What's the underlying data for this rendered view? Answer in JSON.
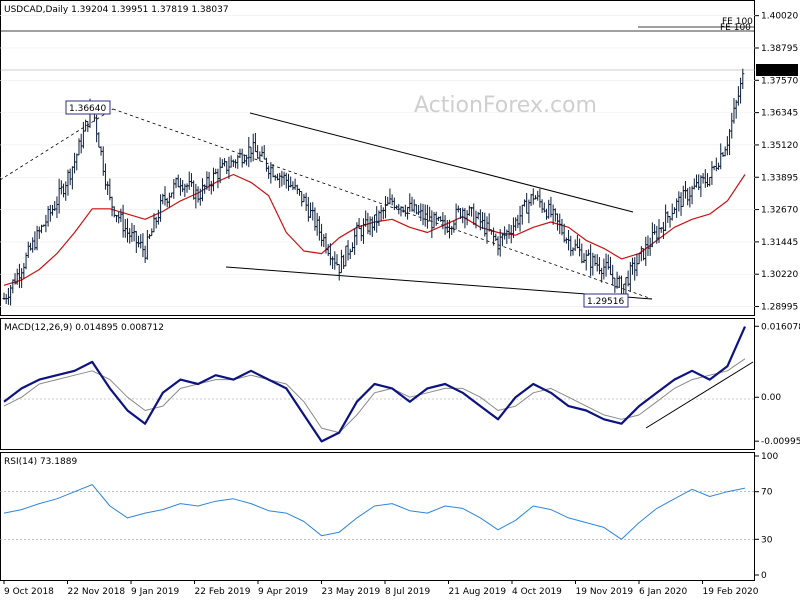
{
  "header": {
    "symbol_line": "USDCAD,Daily  1.39204 1.39951 1.37819 1.38037",
    "watermark": "ActionForex.com",
    "macd_label": "MACD(12,26,9) 0.014895 0.008712",
    "rsi_label": "RSI(14) 73.1889"
  },
  "chart_data": [
    {
      "type": "line",
      "panel": "price",
      "title": "USDCAD,Daily  1.39204 1.39951 1.37819 1.38037",
      "ylim": [
        1.2875,
        1.405
      ],
      "y_ticks": [
        "1.40020",
        "1.38795",
        "1.37570",
        "1.36345",
        "1.35120",
        "1.33895",
        "1.32670",
        "1.31445",
        "1.30220",
        "1.28995"
      ],
      "last_price": "1.38037",
      "annotations": [
        {
          "text": "1.36640",
          "date_index": 49,
          "value": 1.3664
        },
        {
          "text": "1.29516",
          "date_index": 315,
          "value": 1.29516
        },
        {
          "text": "FE 100",
          "value": 1.3936
        },
        {
          "text": "FE 100",
          "value": 1.392
        }
      ],
      "x": [
        "9 Oct 2018",
        "22 Nov 2018",
        "9 Jan 2019",
        "22 Feb 2019",
        "9 Apr 2019",
        "23 May 2019",
        "8 Jul 2019",
        "21 Aug 2019",
        "4 Oct 2019",
        "19 Nov 2019",
        "6 Jan 2020",
        "19 Feb 2020"
      ],
      "series": [
        {
          "values": [
            1.293,
            1.305,
            1.318,
            1.33,
            1.345,
            1.366,
            1.33,
            1.318,
            1.311,
            1.33,
            1.338,
            1.332,
            1.34,
            1.345,
            1.35,
            1.343,
            1.338,
            1.33,
            1.317,
            1.305,
            1.318,
            1.322,
            1.33,
            1.327,
            1.323,
            1.32,
            1.327,
            1.322,
            1.314,
            1.322,
            1.332,
            1.325,
            1.315,
            1.308,
            1.305,
            1.297,
            1.308,
            1.318,
            1.328,
            1.334,
            1.339,
            1.353,
            1.38
          ]
        },
        {
          "values": [
            1.298,
            1.3,
            1.304,
            1.31,
            1.318,
            1.327,
            1.327,
            1.325,
            1.323,
            1.326,
            1.33,
            1.333,
            1.337,
            1.34,
            1.337,
            1.332,
            1.318,
            1.311,
            1.31,
            1.316,
            1.32,
            1.322,
            1.323,
            1.32,
            1.318,
            1.321,
            1.324,
            1.32,
            1.318,
            1.317,
            1.32,
            1.322,
            1.32,
            1.315,
            1.312,
            1.308,
            1.31,
            1.315,
            1.32,
            1.323,
            1.325,
            1.33,
            1.34
          ]
        }
      ]
    },
    {
      "type": "line",
      "panel": "macd",
      "title": "MACD(12,26,9) 0.014895 0.008712",
      "ylim": [
        -0.0115,
        0.0175
      ],
      "y_ticks": [
        "0.016078",
        "0.00",
        "-0.009956"
      ],
      "series": [
        {
          "values": [
            -0.001,
            0.002,
            0.004,
            0.005,
            0.006,
            0.008,
            0.002,
            -0.003,
            -0.006,
            0.001,
            0.004,
            0.003,
            0.005,
            0.004,
            0.006,
            0.004,
            0.002,
            -0.004,
            -0.01,
            -0.008,
            -0.001,
            0.003,
            0.002,
            -0.001,
            0.002,
            0.003,
            0.001,
            -0.002,
            -0.005,
            0.0,
            0.003,
            0.001,
            -0.002,
            -0.003,
            -0.005,
            -0.006,
            -0.002,
            0.001,
            0.004,
            0.006,
            0.004,
            0.007,
            0.016
          ]
        },
        {
          "values": [
            -0.002,
            0.0,
            0.003,
            0.004,
            0.005,
            0.006,
            0.004,
            0.0,
            -0.003,
            -0.002,
            0.002,
            0.003,
            0.004,
            0.004,
            0.005,
            0.004,
            0.003,
            -0.001,
            -0.007,
            -0.008,
            -0.004,
            0.001,
            0.002,
            0.0,
            0.001,
            0.002,
            0.002,
            0.0,
            -0.003,
            -0.002,
            0.001,
            0.002,
            0.0,
            -0.002,
            -0.004,
            -0.005,
            -0.004,
            -0.001,
            0.002,
            0.004,
            0.005,
            0.006,
            0.0087
          ]
        }
      ]
    },
    {
      "type": "line",
      "panel": "rsi",
      "title": "RSI(14) 73.1889",
      "ylim": [
        0,
        100
      ],
      "y_ticks": [
        "100",
        "70",
        "30",
        "0"
      ],
      "series": [
        {
          "values": [
            52,
            55,
            60,
            64,
            70,
            76,
            58,
            48,
            52,
            55,
            60,
            58,
            62,
            64,
            60,
            54,
            52,
            45,
            33,
            36,
            48,
            58,
            60,
            54,
            52,
            58,
            56,
            48,
            38,
            46,
            58,
            55,
            48,
            44,
            40,
            30,
            44,
            56,
            64,
            72,
            66,
            70,
            73
          ]
        }
      ]
    }
  ]
}
